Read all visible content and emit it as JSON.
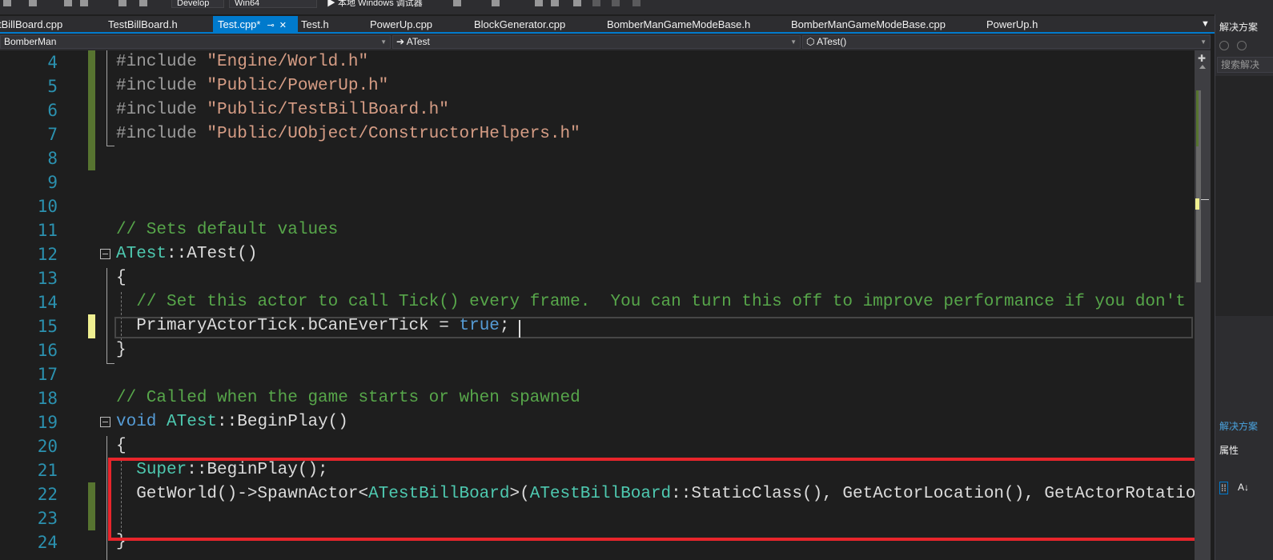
{
  "toolbar": {
    "config_label": "Develop",
    "platform_label": "Win64",
    "run_label": "▶ 本地 Windows 调试器"
  },
  "tabs": [
    {
      "label": "tBillBoard.cpp",
      "active": false
    },
    {
      "label": "TestBillBoard.h",
      "active": false
    },
    {
      "label": "Test.cpp*",
      "active": true
    },
    {
      "label": "Test.h",
      "active": false
    },
    {
      "label": "PowerUp.cpp",
      "active": false
    },
    {
      "label": "BlockGenerator.cpp",
      "active": false
    },
    {
      "label": "BomberManGameModeBase.h",
      "active": false
    },
    {
      "label": "BomberManGameModeBase.cpp",
      "active": false
    },
    {
      "label": "PowerUp.h",
      "active": false
    }
  ],
  "nav": {
    "project": "BomberMan",
    "scope": "➔ ATest",
    "member": "⬡ ATest()"
  },
  "editor": {
    "lines": [
      {
        "n": "4",
        "tokens": [
          {
            "t": "#include ",
            "c": "pp"
          },
          {
            "t": "\"Engine/World.h\"",
            "c": "str"
          }
        ]
      },
      {
        "n": "5",
        "tokens": [
          {
            "t": "#include ",
            "c": "pp"
          },
          {
            "t": "\"Public/PowerUp.h\"",
            "c": "str"
          }
        ]
      },
      {
        "n": "6",
        "tokens": [
          {
            "t": "#include ",
            "c": "pp"
          },
          {
            "t": "\"Public/TestBillBoard.h\"",
            "c": "str"
          }
        ]
      },
      {
        "n": "7",
        "tokens": [
          {
            "t": "#include ",
            "c": "pp"
          },
          {
            "t": "\"Public/UObject/ConstructorHelpers.h\"",
            "c": "str"
          }
        ]
      },
      {
        "n": "8",
        "tokens": []
      },
      {
        "n": "9",
        "tokens": []
      },
      {
        "n": "10",
        "tokens": []
      },
      {
        "n": "11",
        "tokens": [
          {
            "t": "// Sets default values",
            "c": "cm"
          }
        ]
      },
      {
        "n": "12",
        "tokens": [
          {
            "t": "ATest",
            "c": "ty"
          },
          {
            "t": "::",
            "c": ""
          },
          {
            "t": "ATest",
            "c": ""
          },
          {
            "t": "()",
            "c": ""
          }
        ]
      },
      {
        "n": "13",
        "tokens": [
          {
            "t": "{",
            "c": ""
          }
        ]
      },
      {
        "n": "14",
        "tokens": [
          {
            "t": "  ",
            "c": ""
          },
          {
            "t": "// Set this actor to call Tick() every frame.  You can turn this off to improve performance if you don't n",
            "c": "cm"
          }
        ]
      },
      {
        "n": "15",
        "tokens": [
          {
            "t": "  PrimaryActorTick.bCanEverTick = ",
            "c": ""
          },
          {
            "t": "true",
            "c": "kw"
          },
          {
            "t": ";",
            "c": ""
          }
        ]
      },
      {
        "n": "16",
        "tokens": [
          {
            "t": "}",
            "c": ""
          }
        ]
      },
      {
        "n": "17",
        "tokens": []
      },
      {
        "n": "18",
        "tokens": [
          {
            "t": "// Called when the game starts or when spawned",
            "c": "cm"
          }
        ]
      },
      {
        "n": "19",
        "tokens": [
          {
            "t": "void ",
            "c": "kw"
          },
          {
            "t": "ATest",
            "c": "ty"
          },
          {
            "t": "::",
            "c": ""
          },
          {
            "t": "BeginPlay",
            "c": ""
          },
          {
            "t": "()",
            "c": ""
          }
        ]
      },
      {
        "n": "20",
        "tokens": [
          {
            "t": "{",
            "c": ""
          }
        ]
      },
      {
        "n": "21",
        "tokens": [
          {
            "t": "  ",
            "c": ""
          },
          {
            "t": "Super",
            "c": "ty"
          },
          {
            "t": "::BeginPlay();",
            "c": ""
          }
        ]
      },
      {
        "n": "22",
        "tokens": [
          {
            "t": "  GetWorld()->SpawnActor<",
            "c": ""
          },
          {
            "t": "ATestBillBoard",
            "c": "ty"
          },
          {
            "t": ">(",
            "c": ""
          },
          {
            "t": "ATestBillBoard",
            "c": "ty"
          },
          {
            "t": "::StaticClass(), GetActorLocation(), GetActorRotation",
            "c": ""
          }
        ]
      },
      {
        "n": "23",
        "tokens": []
      },
      {
        "n": "24",
        "tokens": [
          {
            "t": "}",
            "c": ""
          }
        ]
      }
    ]
  },
  "side": {
    "title": "解决方案",
    "search_placeholder": "搜索解决",
    "panel_label": "解决方案",
    "props_label": "属性"
  },
  "colors": {
    "accent": "#007acc",
    "highlight_box": "#e8252b",
    "change_saved": "#577430",
    "change_unsaved": "#efef91"
  }
}
